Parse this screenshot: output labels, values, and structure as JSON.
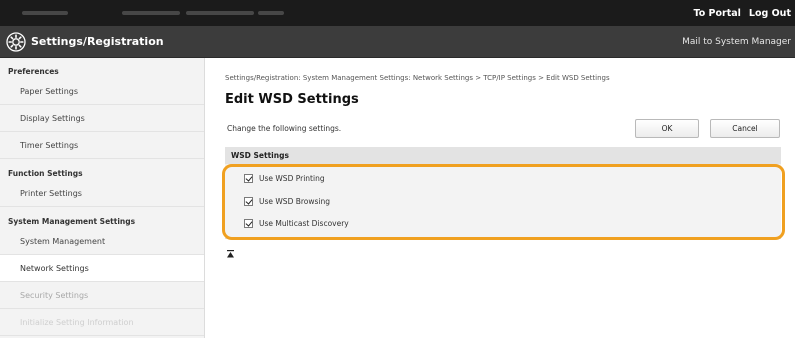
{
  "topbar": {
    "portal_link": "To Portal",
    "logout_link": "Log Out"
  },
  "header": {
    "title": "Settings/Registration",
    "mail_link": "Mail to System Manager",
    "logo_icon": "settings-gear-icon"
  },
  "sidebar": {
    "sections": [
      {
        "heading": "Preferences",
        "items": [
          "Paper Settings",
          "Display Settings",
          "Timer Settings"
        ]
      },
      {
        "heading": "Function Settings",
        "items": [
          "Printer Settings"
        ]
      },
      {
        "heading": "System Management Settings",
        "items": [
          "System Management",
          "Network Settings",
          "Security Settings",
          "Initialize Setting Information"
        ]
      }
    ],
    "active_item": "Network Settings"
  },
  "main": {
    "breadcrumb": "Settings/Registration: System Management Settings: Network Settings > TCP/IP Settings > Edit WSD Settings",
    "title": "Edit WSD Settings",
    "description": "Change the following settings.",
    "ok_label": "OK",
    "cancel_label": "Cancel",
    "section_title": "WSD Settings",
    "options": [
      {
        "label": "Use WSD Printing",
        "checked": true
      },
      {
        "label": "Use WSD Browsing",
        "checked": true
      },
      {
        "label": "Use Multicast Discovery",
        "checked": true
      }
    ],
    "top_icon": "scroll-to-top-icon"
  },
  "colors": {
    "highlight": "#f0a020",
    "header_bg": "#3c3c3c",
    "topbar_bg": "#1b1b1b"
  }
}
